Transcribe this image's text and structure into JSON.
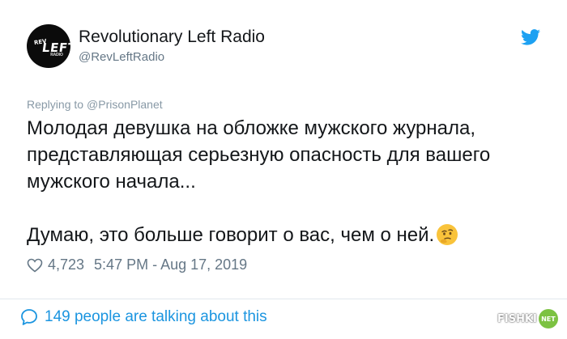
{
  "account": {
    "display_name": "Revolutionary Left Radio",
    "handle": "@RevLeftRadio",
    "avatar_text": {
      "rev": "REV",
      "left": "LEFT",
      "radio": "RADIO"
    }
  },
  "icons": {
    "platform": "twitter-bird-icon",
    "like": "heart-icon",
    "conversation": "speech-bubble-icon",
    "emoji": "thinking-face-emoji"
  },
  "reply": {
    "prefix": "Replying to",
    "to": "@PrisonPlanet"
  },
  "tweet": {
    "paragraph1": "Молодая девушка на обложке мужского журнала, представляющая серьезную опасность для вашего мужского начала...",
    "paragraph2": "Думаю, это больше говорит о вас, чем о ней."
  },
  "meta": {
    "likes": "4,723",
    "timestamp": "5:47 PM - Aug 17, 2019"
  },
  "footer": {
    "conversation_text": "149 people are talking about this"
  },
  "watermark": {
    "brand": "FISHKI",
    "badge": "NET"
  },
  "colors": {
    "twitter_blue": "#1da1f2",
    "link_blue": "#1b95e0",
    "secondary_text": "#657786",
    "primary_text": "#14171a",
    "divider": "#e1e8ed"
  }
}
